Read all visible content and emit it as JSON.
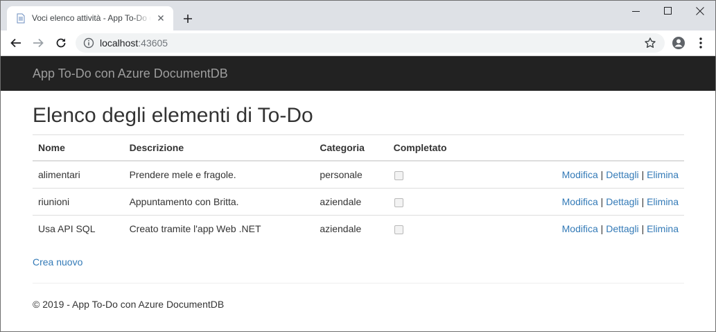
{
  "browser": {
    "tab_title": "Voci elenco attività - App To-Do con Azure DocumentDB",
    "url_host": "localhost",
    "url_port": ":43605",
    "icons": [
      "page-icon",
      "close-icon",
      "plus-icon",
      "minimize-icon",
      "maximize-icon",
      "window-close-icon",
      "back-arrow-icon",
      "forward-arrow-icon",
      "reload-icon",
      "info-icon",
      "star-icon",
      "account-icon",
      "more-vert-icon"
    ]
  },
  "navbar": {
    "brand": "App To-Do con Azure DocumentDB"
  },
  "page": {
    "title": "Elenco degli elementi di To-Do",
    "columns": {
      "name": "Nome",
      "description": "Descrizione",
      "category": "Categoria",
      "completed": "Completato"
    },
    "rows": [
      {
        "name": "alimentari",
        "description": "Prendere mele e fragole.",
        "category": "personale",
        "completed": false
      },
      {
        "name": "riunioni",
        "description": "Appuntamento con Britta.",
        "category": "aziendale",
        "completed": false
      },
      {
        "name": "Usa API SQL",
        "description": "Creato tramite l'app Web .NET",
        "category": "aziendale",
        "completed": false
      }
    ],
    "actions": {
      "edit": "Modifica",
      "details": "Dettagli",
      "delete": "Elimina",
      "separator": "|"
    },
    "create_new": "Crea nuovo"
  },
  "footer": {
    "text": "© 2019 - App To-Do con Azure DocumentDB"
  },
  "colors": {
    "navbar_bg": "#222222",
    "brand_text": "#9d9d9d",
    "link": "#337ab7",
    "tabstrip_bg": "#dee1e6"
  }
}
